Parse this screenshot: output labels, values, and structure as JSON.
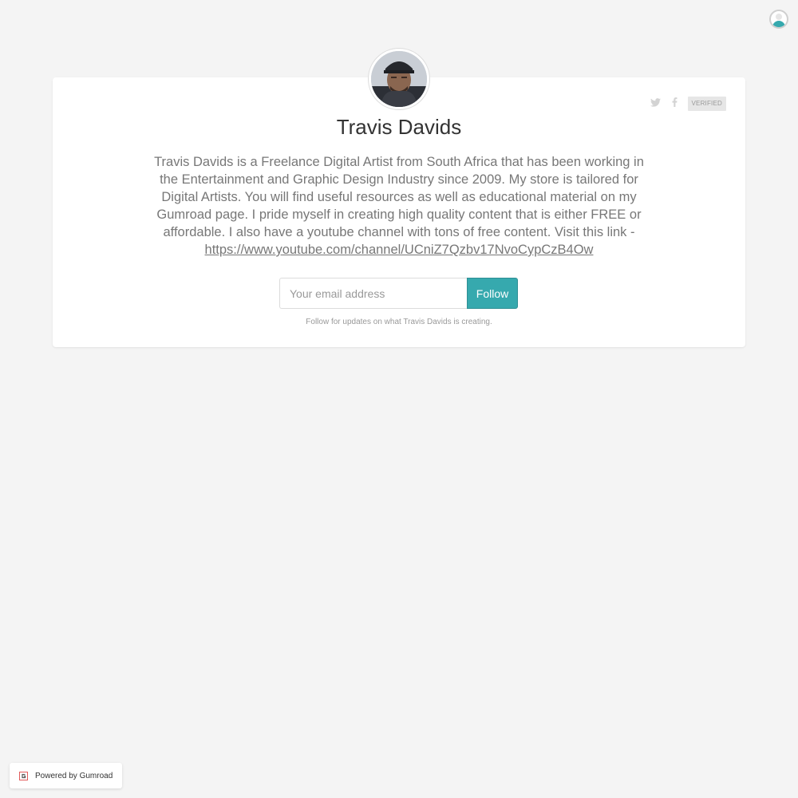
{
  "profile": {
    "name": "Travis Davids",
    "badge": "VERIFIED",
    "bio_text": "Travis Davids is a Freelance Digital Artist from South Africa that has been working in the Entertainment and Graphic Design Industry since 2009. My store is tailored for Digital Artists. You will find useful resources as well as educational material on my Gumroad page. I pride myself in creating high quality content that is either FREE or affordable. I also have a youtube channel with tons of free content. Visit this link -",
    "bio_link": "https://www.youtube.com/channel/UCniZ7Qzbv17NvoCypCzB4Ow"
  },
  "social": {
    "icons": [
      "twitter-icon",
      "facebook-icon"
    ]
  },
  "follow": {
    "email_placeholder": "Your email address",
    "button_label": "Follow",
    "hint": "Follow for updates on what Travis Davids is creating."
  },
  "footer": {
    "powered_by": "Powered by Gumroad"
  },
  "colors": {
    "accent": "#36a9ae",
    "background": "#f4f4f4",
    "card": "#ffffff"
  }
}
